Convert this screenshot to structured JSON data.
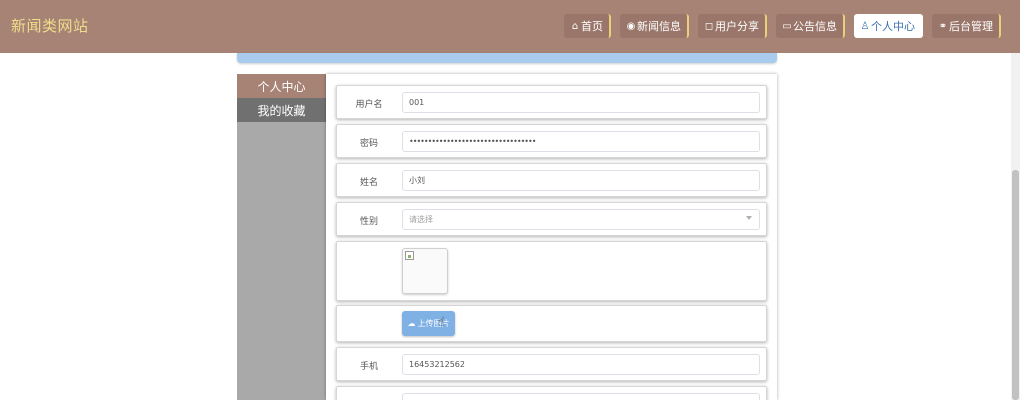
{
  "header": {
    "site_title": "新闻类网站",
    "nav": [
      {
        "icon": "home-icon",
        "glyph": "⌂",
        "label": "首页"
      },
      {
        "icon": "globe-icon",
        "glyph": "◉",
        "label": "新闻信息"
      },
      {
        "icon": "bookmark-icon",
        "glyph": "◻",
        "label": "用户分享"
      },
      {
        "icon": "notice-icon",
        "glyph": "▭",
        "label": "公告信息"
      },
      {
        "icon": "user-icon",
        "glyph": "♙",
        "label": "个人中心"
      },
      {
        "icon": "link-icon",
        "glyph": "⚭",
        "label": "后台管理"
      }
    ],
    "active_nav": "个人中心"
  },
  "sidebar": {
    "items": [
      {
        "label": "个人中心"
      },
      {
        "label": "我的收藏"
      }
    ]
  },
  "form": {
    "username": {
      "label": "用户名",
      "value": "001"
    },
    "password": {
      "label": "密码",
      "value": "••••••••••••••••••••••••••••••••••"
    },
    "name": {
      "label": "姓名",
      "value": "小刘"
    },
    "gender": {
      "label": "性别",
      "placeholder": "请选择"
    },
    "upload": {
      "label": "上传图片",
      "icon": "cloud-upload-icon"
    },
    "phone": {
      "label": "手机",
      "value": "16453212562"
    }
  },
  "colors": {
    "header_bg": "#a78376",
    "title": "#f0dd8a",
    "accent_blue": "#7fb1e4",
    "sidebar_active": "#a78376",
    "sidebar_bg": "#a9a9a9"
  }
}
